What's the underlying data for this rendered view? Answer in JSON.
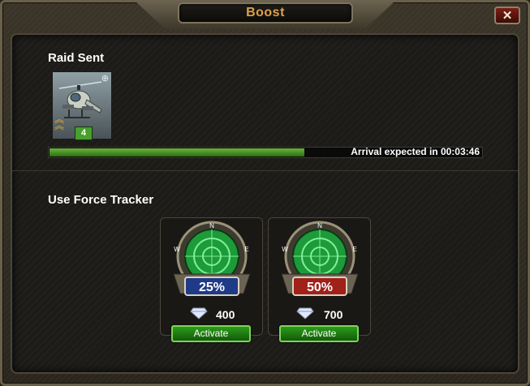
{
  "dialog": {
    "title": "Boost",
    "close_label": "✕"
  },
  "raid": {
    "heading": "Raid Sent",
    "unit": {
      "icon": "attack-helicopter-icon",
      "level": "4",
      "rank_icon": "sergeant-chevron-icon",
      "target_icon": "crosshair-icon"
    },
    "progress": {
      "fraction": 0.59,
      "label": "Arrival expected in 00:03:46",
      "fill_color": "#4e9429"
    }
  },
  "tracker": {
    "heading": "Use Force Tracker",
    "options": [
      {
        "percent": "25%",
        "cost": "400",
        "button": "Activate",
        "badge_color": "#1f3a86",
        "icon": "radar-icon"
      },
      {
        "percent": "50%",
        "cost": "700",
        "button": "Activate",
        "badge_color": "#a0201a",
        "icon": "radar-icon"
      }
    ],
    "currency_icon": "diamond-icon",
    "compass_letters": [
      "N",
      "E",
      "W"
    ]
  },
  "colors": {
    "title_text": "#e0a04a",
    "button_green": "#2c9b1b",
    "background": "#1c1b18"
  }
}
